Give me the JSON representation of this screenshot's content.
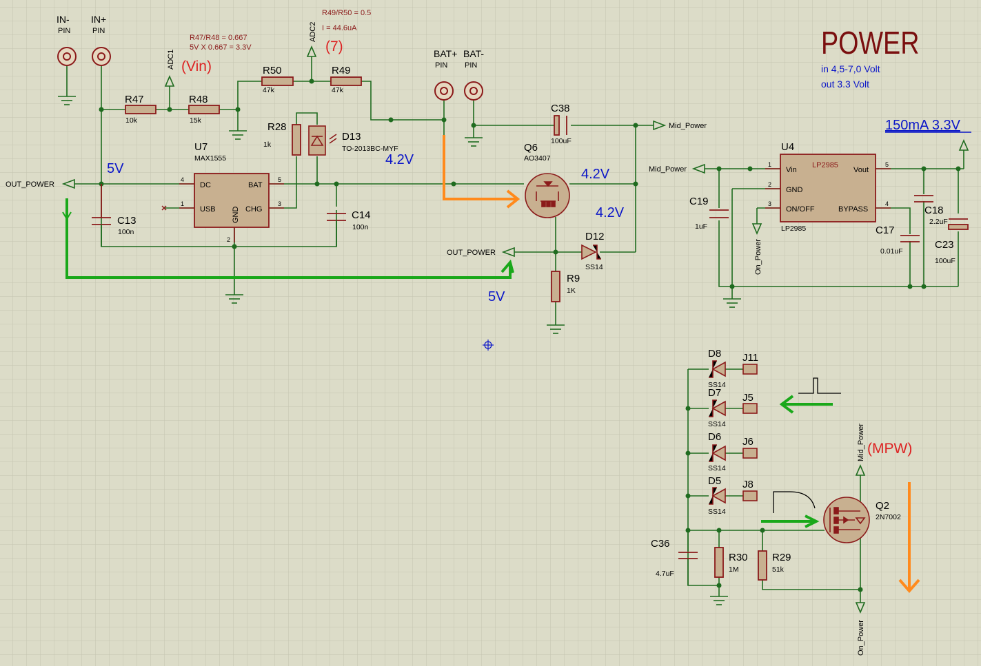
{
  "colors": {
    "background": "#dcdcc8",
    "grid": "#c4c4b0",
    "wire": "#1f6b1f",
    "component": "#8b1a1a",
    "fill": "#c8b090",
    "label": "#000000",
    "blue": "#0b16c8",
    "orange": "#ff8a1c",
    "green": "#1aa81a",
    "red": "#dd2222",
    "power_title": "#7a0f0f"
  },
  "pins": {
    "in_minus": {
      "ref": "IN-",
      "type": "PIN"
    },
    "in_plus": {
      "ref": "IN+",
      "type": "PIN"
    },
    "bat_plus": {
      "ref": "BAT+",
      "type": "PIN"
    },
    "bat_minus": {
      "ref": "BAT-",
      "type": "PIN"
    }
  },
  "components": {
    "R47": {
      "ref": "R47",
      "value": "10k"
    },
    "R48": {
      "ref": "R48",
      "value": "15k"
    },
    "R50": {
      "ref": "R50",
      "value": "47k"
    },
    "R49": {
      "ref": "R49",
      "value": "47k"
    },
    "R28": {
      "ref": "R28",
      "value": "1k"
    },
    "D13": {
      "ref": "D13",
      "value": "TO-2013BC-MYF"
    },
    "U7": {
      "ref": "U7",
      "value": "MAX1555",
      "pins": {
        "dc": "DC",
        "bat": "BAT",
        "usb": "USB",
        "chg": "CHG",
        "gnd": "GND",
        "n1": "1",
        "n2": "2",
        "n3": "3",
        "n4": "4",
        "n5": "5"
      }
    },
    "C13": {
      "ref": "C13",
      "value": "100n"
    },
    "C14": {
      "ref": "C14",
      "value": "100n"
    },
    "C38": {
      "ref": "C38",
      "value": "100uF"
    },
    "Q6": {
      "ref": "Q6",
      "value": "AO3407"
    },
    "D12": {
      "ref": "D12",
      "value": "SS14"
    },
    "R9": {
      "ref": "R9",
      "value": "1K"
    },
    "U4": {
      "ref": "U4",
      "value": "LP2985",
      "chip_label": "LP2985",
      "pins": {
        "vin": "Vin",
        "vout": "Vout",
        "gnd": "GND",
        "onoff": "ON/OFF",
        "bypass": "BYPASS",
        "n1": "1",
        "n2": "2",
        "n3": "3",
        "n4": "4",
        "n5": "5"
      }
    },
    "C19": {
      "ref": "C19",
      "value": "1uF"
    },
    "C17": {
      "ref": "C17",
      "value": "0.01uF"
    },
    "C18": {
      "ref": "C18",
      "value": "2.2uF"
    },
    "C23": {
      "ref": "C23",
      "value": "100uF"
    },
    "D8": {
      "ref": "D8",
      "value": "SS14"
    },
    "D7": {
      "ref": "D7",
      "value": "SS14"
    },
    "D6": {
      "ref": "D6",
      "value": "SS14"
    },
    "D5": {
      "ref": "D5",
      "value": "SS14"
    },
    "J11": {
      "ref": "J11"
    },
    "J5": {
      "ref": "J5"
    },
    "J6": {
      "ref": "J6"
    },
    "J8": {
      "ref": "J8"
    },
    "Q2": {
      "ref": "Q2",
      "value": "2N7002"
    },
    "C36": {
      "ref": "C36",
      "value": "4.7uF"
    },
    "R30": {
      "ref": "R30",
      "value": "1M"
    },
    "R29": {
      "ref": "R29",
      "value": "51k"
    }
  },
  "nets": {
    "adc1": "ADC1",
    "adc2": "ADC2",
    "out_power": "OUT_POWER",
    "mid_power": "Mid_Power",
    "on_power": "On_Power"
  },
  "annotations": {
    "ratio_r47_r48": "R47/R48 = 0.667",
    "calc_5v": "5V X 0.667 = 3.3V",
    "ratio_r49_r50": "R49/R50 = 0.5",
    "current": "I = 44.6uA",
    "vin_tag": "(Vin)",
    "seven_tag": "(7)",
    "mpw_tag": "(MPW)",
    "v5_top": "5V",
    "v42_d13": "4.2V",
    "v42_q6": "4.2V",
    "v42_d12": "4.2V",
    "v5_bottom": "5V",
    "power_title": "POWER",
    "power_in": "in 4,5-7,0 Volt",
    "power_out": "out 3.3 Volt",
    "ldo_spec": "150mA 3.3V"
  }
}
